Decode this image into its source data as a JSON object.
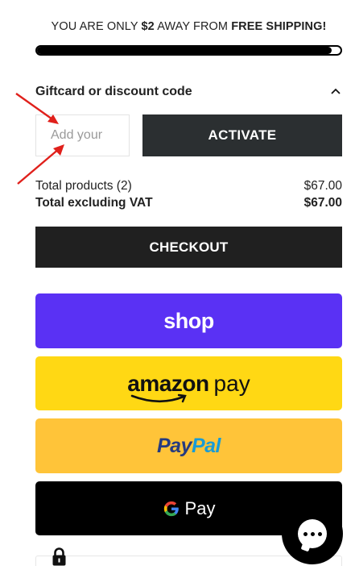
{
  "shipping": {
    "prefix": "YOU ARE ONLY ",
    "amount": "$2",
    "middle": " AWAY FROM ",
    "highlight": "FREE SHIPPING!",
    "progress_fraction": 0.97
  },
  "discount": {
    "title": "Giftcard or discount code",
    "input_placeholder": "Add your",
    "input_value": "",
    "activate_label": "ACTIVATE"
  },
  "totals": {
    "products_label": "Total products (2)",
    "products_value": "$67.00",
    "excl_vat_label": "Total excluding VAT",
    "excl_vat_value": "$67.00"
  },
  "checkout": {
    "label": "CHECKOUT"
  },
  "payments": {
    "shop_label": "shop",
    "amazon_word": "amazon",
    "amazon_pay_word": "pay",
    "paypal_pay": "Pay",
    "paypal_pal": "Pal",
    "gpay_label": "Pay"
  },
  "colors": {
    "shop": "#5a31f4",
    "amazon": "#ffd814",
    "paypal": "#ffc439",
    "gpay": "#000000",
    "annotation_arrow": "#e0201b"
  },
  "icons": [
    "chevron-up-icon",
    "arrow-icon",
    "google-g-icon",
    "amazon-smile-icon",
    "lock-icon",
    "chat-icon"
  ]
}
